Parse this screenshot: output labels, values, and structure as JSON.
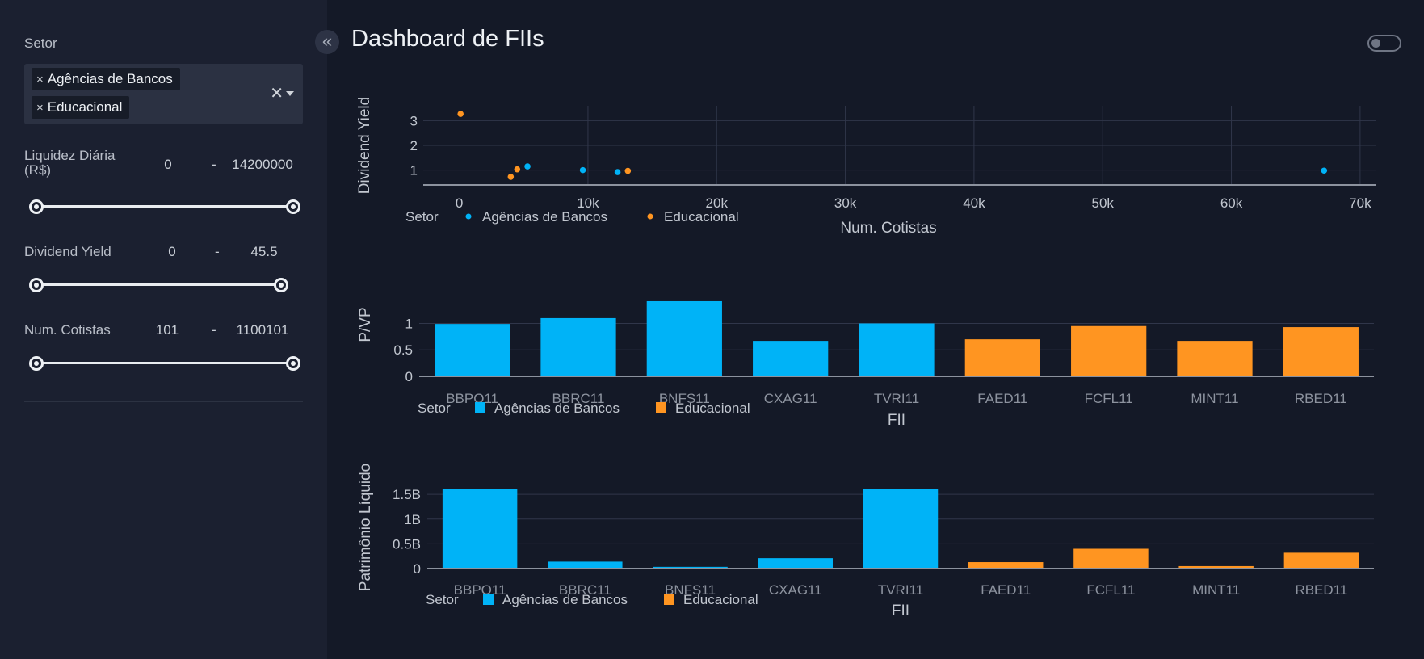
{
  "sidebar": {
    "sector_label": "Setor",
    "selected_sectors": [
      "Agências de Bancos",
      "Educacional"
    ],
    "clear_all_glyph": "✕",
    "chip_remove_glyph": "×",
    "filters": [
      {
        "label": "Liquidez Diária (R$)",
        "min": "0",
        "sep": "-",
        "max": "14200000"
      },
      {
        "label": "Dividend Yield",
        "min": "0",
        "sep": "-",
        "max": "45.5"
      },
      {
        "label": "Num. Cotistas",
        "min": "101",
        "sep": "-",
        "max": "1100101"
      }
    ]
  },
  "header": {
    "title": "Dashboard de FIIs",
    "collapse_glyph": "«",
    "theme_toggle_on": false
  },
  "colors": {
    "agencias": "#00b3f7",
    "educacional": "#ff9521",
    "axis": "#8c929e",
    "grid": "#30364a",
    "text": "#c2c7d0"
  },
  "legend": {
    "title": "Setor",
    "entries": [
      "Agências de Bancos",
      "Educacional"
    ]
  },
  "chart_data": [
    {
      "type": "scatter",
      "xlabel": "Num. Cotistas",
      "ylabel": "Dividend Yield",
      "xticks": [
        "0",
        "10k",
        "20k",
        "30k",
        "40k",
        "50k",
        "60k",
        "70k"
      ],
      "yticks": [
        "1",
        "2",
        "3"
      ],
      "xlim": [
        -2800,
        71200
      ],
      "ylim": [
        0.4,
        3.6
      ],
      "series": [
        {
          "name": "Agências de Bancos",
          "points": [
            [
              5300,
              1.15
            ],
            [
              9600,
              1.0
            ],
            [
              12300,
              0.92
            ],
            [
              67200,
              0.98
            ]
          ]
        },
        {
          "name": "Educacional",
          "points": [
            [
              100,
              3.27
            ],
            [
              4000,
              0.73
            ],
            [
              4500,
              1.03
            ],
            [
              13100,
              0.97
            ]
          ]
        }
      ]
    },
    {
      "type": "bar",
      "xlabel": "FII",
      "ylabel": "P/VP",
      "categories": [
        "BBPO11",
        "BBRC11",
        "BNFS11",
        "CXAG11",
        "TVRI11",
        "FAED11",
        "FCFL11",
        "MINT11",
        "RBED11"
      ],
      "values": [
        0.99,
        1.1,
        1.42,
        0.67,
        1.0,
        0.7,
        0.95,
        0.67,
        0.93
      ],
      "sectors": [
        "Agências de Bancos",
        "Agências de Bancos",
        "Agências de Bancos",
        "Agências de Bancos",
        "Agências de Bancos",
        "Educacional",
        "Educacional",
        "Educacional",
        "Educacional"
      ],
      "yticks": [
        "0",
        "0.5",
        "1"
      ],
      "ylim": [
        0,
        1.45
      ]
    },
    {
      "type": "bar",
      "xlabel": "FII",
      "ylabel": "Patrimônio Líquido",
      "categories": [
        "BBPO11",
        "BBRC11",
        "BNFS11",
        "CXAG11",
        "TVRI11",
        "FAED11",
        "FCFL11",
        "MINT11",
        "RBED11"
      ],
      "values": [
        1.6,
        0.14,
        0.035,
        0.21,
        1.6,
        0.13,
        0.4,
        0.05,
        0.32
      ],
      "sectors": [
        "Agências de Bancos",
        "Agências de Bancos",
        "Agências de Bancos",
        "Agências de Bancos",
        "Agências de Bancos",
        "Educacional",
        "Educacional",
        "Educacional",
        "Educacional"
      ],
      "yticks": [
        "0",
        "0.5B",
        "1B",
        "1.5B"
      ],
      "ylim": [
        0,
        1.6
      ]
    }
  ]
}
